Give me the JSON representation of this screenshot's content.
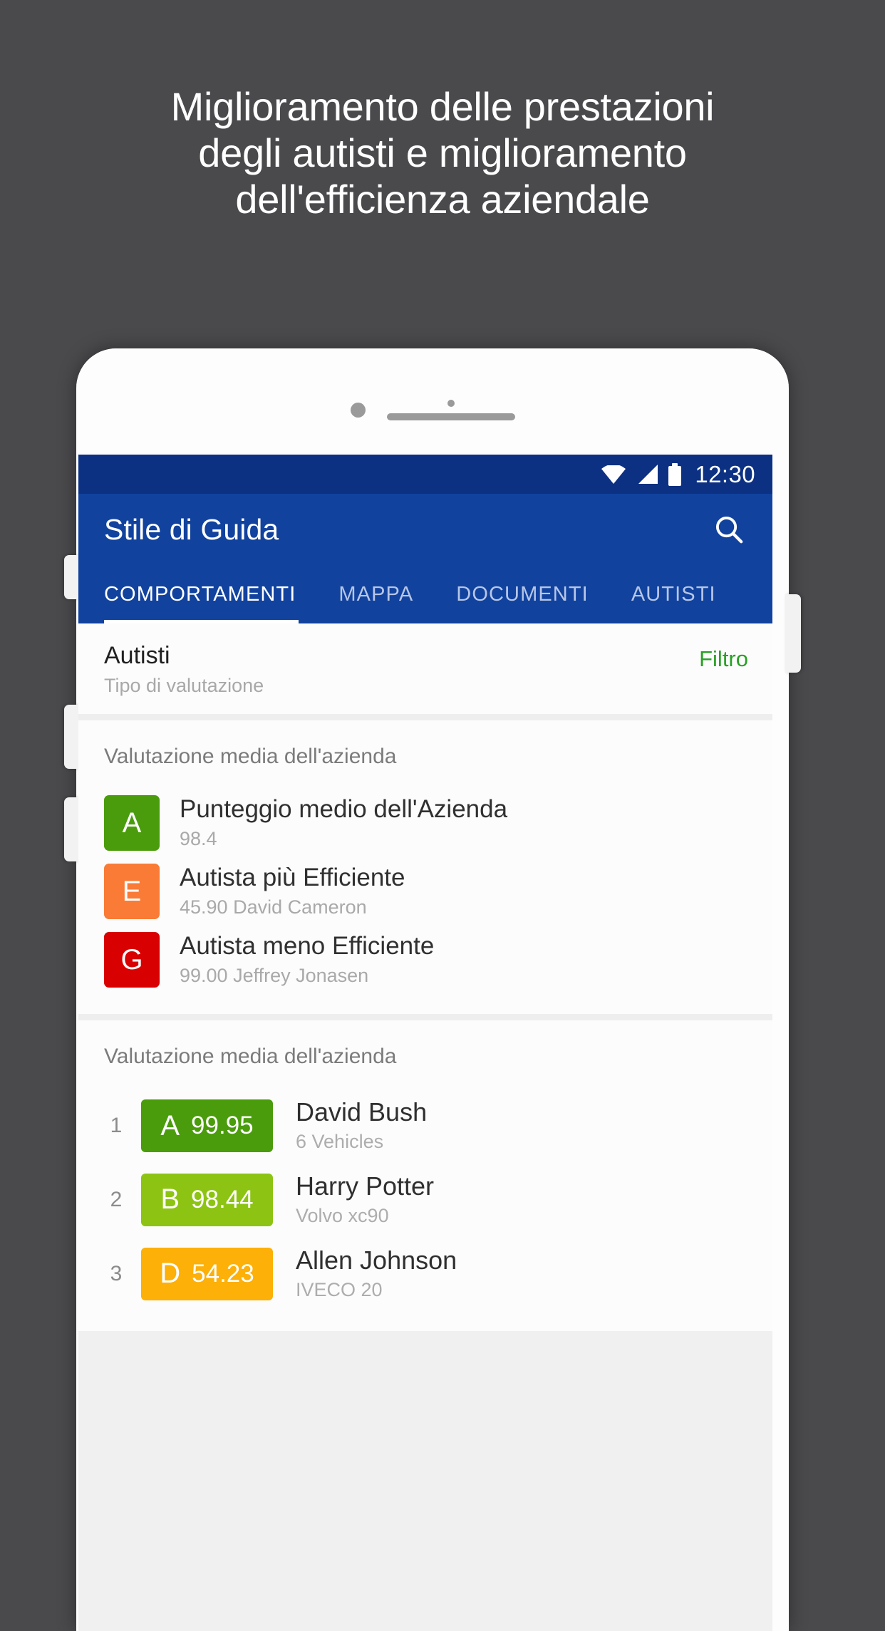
{
  "headline": {
    "line1": "Miglioramento delle prestazioni",
    "line2": "degli autisti e miglioramento",
    "line3": "dell'efficienza aziendale"
  },
  "statusbar": {
    "time": "12:30",
    "wifi_icon": "wifi-icon",
    "signal_icon": "signal-icon",
    "battery_icon": "battery-icon"
  },
  "appbar": {
    "title": "Stile di Guida",
    "search_icon": "search-icon"
  },
  "tabs": [
    {
      "label": "COMPORTAMENTI",
      "active": true
    },
    {
      "label": "MAPPA",
      "active": false
    },
    {
      "label": "DOCUMENTI",
      "active": false
    },
    {
      "label": "AUTISTI",
      "active": false
    }
  ],
  "filter_row": {
    "title": "Autisti",
    "subtitle": "Tipo di valutazione",
    "filter_label": "Filtro",
    "filter_color": "#29a125"
  },
  "company_section": {
    "title": "Valutazione media dell'azienda",
    "items": [
      {
        "grade": "A",
        "color": "#4a9c0c",
        "label": "Punteggio medio dell'Azienda",
        "value": "98.4"
      },
      {
        "grade": "E",
        "color": "#f97b36",
        "label": "Autista più Efficiente",
        "value": "45.90 David Cameron"
      },
      {
        "grade": "G",
        "color": "#d80000",
        "label": "Autista meno Efficiente",
        "value": "99.00 Jeffrey Jonasen"
      }
    ]
  },
  "ranking_section": {
    "title": "Valutazione media dell'azienda",
    "rows": [
      {
        "rank": "1",
        "grade": "A",
        "score": "99.95",
        "color": "#4a9c0c",
        "name": "David Bush",
        "sub": "6 Vehicles"
      },
      {
        "rank": "2",
        "grade": "B",
        "score": "98.44",
        "color": "#8dc413",
        "name": "Harry Potter",
        "sub": "Volvo xc90"
      },
      {
        "rank": "3",
        "grade": "D",
        "score": "54.23",
        "color": "#fcb008",
        "name": "Allen Johnson",
        "sub": "IVECO 20"
      }
    ]
  },
  "theme": {
    "background": "#4a4a4d",
    "statusbar_bg": "#0c3182",
    "appbar_bg": "#11429e"
  }
}
